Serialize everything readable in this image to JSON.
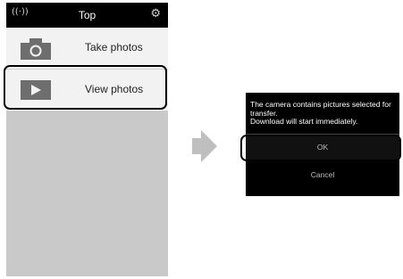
{
  "status_bar": {
    "title": "Top",
    "wifi_icon": "wifi-icon",
    "settings_icon": "gear-icon"
  },
  "menu": {
    "items": [
      {
        "label": "Take photos",
        "icon": "camera-icon"
      },
      {
        "label": "View photos",
        "icon": "play-icon"
      }
    ]
  },
  "dialog": {
    "message": "The camera contains pictures selected for transfer.\nDownload will start immediately.",
    "ok_label": "OK",
    "cancel_label": "Cancel"
  },
  "colors": {
    "highlight": "#000000",
    "dialog_bg": "#000000",
    "arrow": "#bfbfbf"
  }
}
